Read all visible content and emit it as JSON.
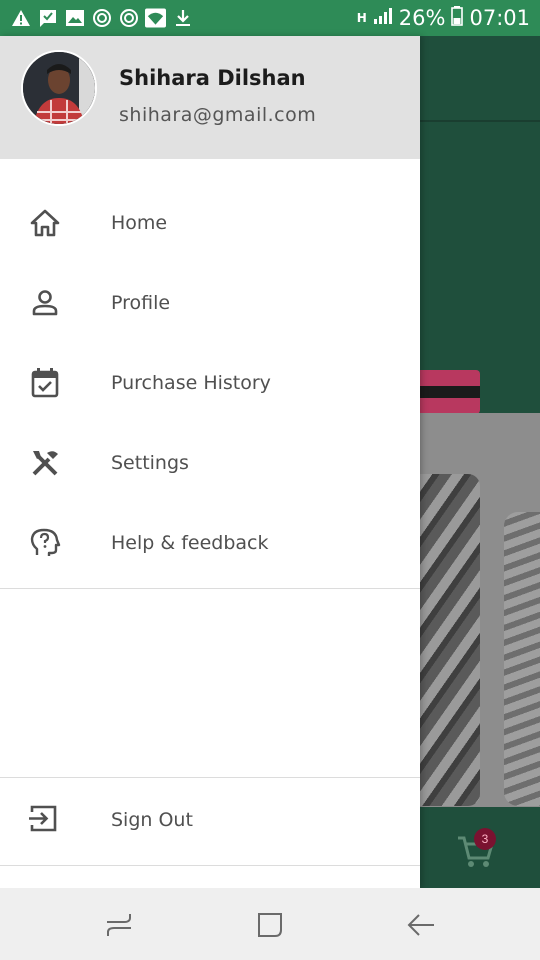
{
  "status_bar": {
    "battery": "26%",
    "time": "07:01",
    "network": "H",
    "notification_icons": [
      "warning-icon",
      "message-icon",
      "image-icon",
      "sync-icon",
      "sync-icon",
      "wifi-icon",
      "download-icon"
    ]
  },
  "drawer": {
    "user": {
      "name": "Shihara Dilshan",
      "email": "shihara@gmail.com"
    },
    "menu": [
      {
        "label": "Home",
        "icon": "home-icon"
      },
      {
        "label": "Profile",
        "icon": "person-icon"
      },
      {
        "label": "Purchase History",
        "icon": "calendar-check-icon"
      },
      {
        "label": "Settings",
        "icon": "tools-icon"
      },
      {
        "label": "Help & feedback",
        "icon": "help-head-icon"
      }
    ],
    "sign_out": {
      "label": "Sign Out",
      "icon": "sign-out-icon"
    }
  },
  "background_app": {
    "cart_count": "3"
  },
  "colors": {
    "status_bar": "#2e8b57",
    "app_primary": "#1f4f3c",
    "drawer_header": "#e1e1e1",
    "badge": "#7a1230"
  }
}
